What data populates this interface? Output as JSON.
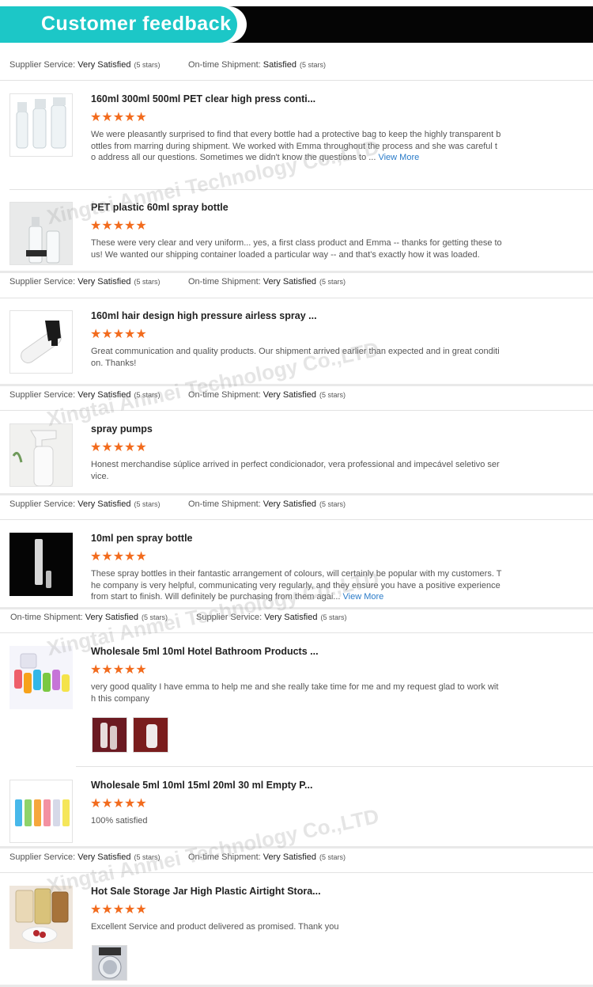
{
  "header": {
    "title": "Customer feedback"
  },
  "labels": {
    "supplier": "Supplier Service:",
    "shipment": "On-time Shipment:",
    "view_more": "View More"
  },
  "stars_glyph": "★★★★★",
  "rating_bars": [
    {
      "left_label": "Supplier Service:",
      "left_val": "Very Satisfied",
      "left_note": "(5 stars)",
      "right_label": "On-time Shipment:",
      "right_val": "Satisfied",
      "right_note": "(5 stars)"
    },
    {
      "left_label": "Supplier Service:",
      "left_val": "Very Satisfied",
      "left_note": "(5 stars)",
      "right_label": "On-time Shipment:",
      "right_val": "Very Satisfied",
      "right_note": "(5 stars)"
    },
    {
      "left_label": "Supplier Service:",
      "left_val": "Very Satisfied",
      "left_note": "(5 stars)",
      "right_label": "On-time Shipment:",
      "right_val": "Very Satisfied",
      "right_note": "(5 stars)"
    },
    {
      "left_label": "Supplier Service:",
      "left_val": "Very Satisfied",
      "left_note": "(5 stars)",
      "right_label": "On-time Shipment:",
      "right_val": "Very Satisfied",
      "right_note": "(5 stars)"
    },
    {
      "left_label": "On-time Shipment:",
      "left_val": "Very Satisfied",
      "left_note": "(5 stars)",
      "right_label": "Supplier Service:",
      "right_val": "Very Satisfied",
      "right_note": "(5 stars)"
    },
    {
      "left_label": "Supplier Service:",
      "left_val": "Very Satisfied",
      "left_note": "(5 stars)",
      "right_label": "On-time Shipment:",
      "right_val": "Very Satisfied",
      "right_note": "(5 stars)"
    }
  ],
  "reviews": [
    {
      "title": "160ml 300ml 500ml PET clear high press conti...",
      "text": "We were pleasantly surprised to find that every bottle had a protective bag to keep the highly transparent bottles from marring during shipment. We worked with Emma throughout the process and she was careful to address all our questions. Sometimes we didn't know the questions to ...",
      "view_more": "View More"
    },
    {
      "title": "PET plastic 60ml spray bottle",
      "text": "These were very clear and very uniform... yes, a first class product and Emma -- thanks for getting these to us! We wanted our shipping container loaded a particular way -- and that's exactly how it was loaded."
    },
    {
      "title": "160ml hair design high pressure airless spray ...",
      "text": "Great communication and quality products. Our shipment arrived earlier than expected and in great condition. Thanks!"
    },
    {
      "title": "spray pumps",
      "text": "Honest merchandise súplice arrived in perfect condicionador, vera professional and impecável seletivo service."
    },
    {
      "title": "10ml pen spray bottle",
      "text": "These spray bottles in their fantastic arrangement of colours, will certainly be popular with my customers. The company is very helpful, communicating very regularly, and they ensure you have a positive experience from start to finish. Will definitely be purchasing from them agai...",
      "view_more": "View More"
    },
    {
      "title": "Wholesale 5ml 10ml Hotel Bathroom Products ...",
      "text": "very good quality I have emma to help me and she really take time for me and my request glad to work with this company"
    },
    {
      "title": "Wholesale 5ml 10ml 15ml 20ml 30 ml Empty P...",
      "text": "100% satisfied"
    },
    {
      "title": "Hot Sale Storage Jar High Plastic Airtight Stora...",
      "text": "Excellent Service and product delivered as promised. Thank you"
    }
  ],
  "watermark": "Xingtai Anmei Technology Co.,LTD",
  "colors": {
    "accent_teal": "#1cc7c7",
    "star_orange": "#f26b1d",
    "link_blue": "#2a7bc8"
  }
}
